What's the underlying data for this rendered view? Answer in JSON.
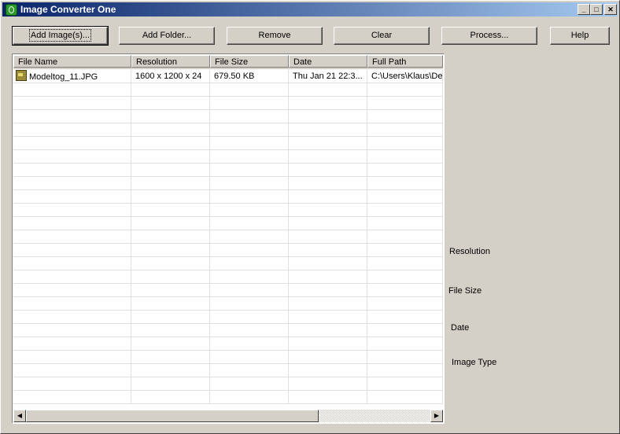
{
  "window": {
    "title": "Image Converter One",
    "controls": {
      "minimize": "_",
      "maximize": "□",
      "close": "✕"
    }
  },
  "toolbar": {
    "add_images": "Add Image(s)...",
    "add_folder": "Add Folder...",
    "remove": "Remove",
    "clear": "Clear",
    "process": "Process...",
    "help": "Help"
  },
  "list": {
    "columns": [
      "File Name",
      "Resolution",
      "File Size",
      "Date",
      "Full Path"
    ],
    "rows": [
      {
        "icon": "jpg-file-icon",
        "name": "Modeltog_11.JPG",
        "resolution": "1600 x 1200 x 24",
        "size": "679.50 KB",
        "date": "Thu Jan 21 22:3...",
        "path": "C:\\Users\\Klaus\\De"
      }
    ]
  },
  "info": {
    "resolution": "Resolution",
    "file_size": "File Size",
    "date": "Date",
    "image_type": "Image Type"
  }
}
